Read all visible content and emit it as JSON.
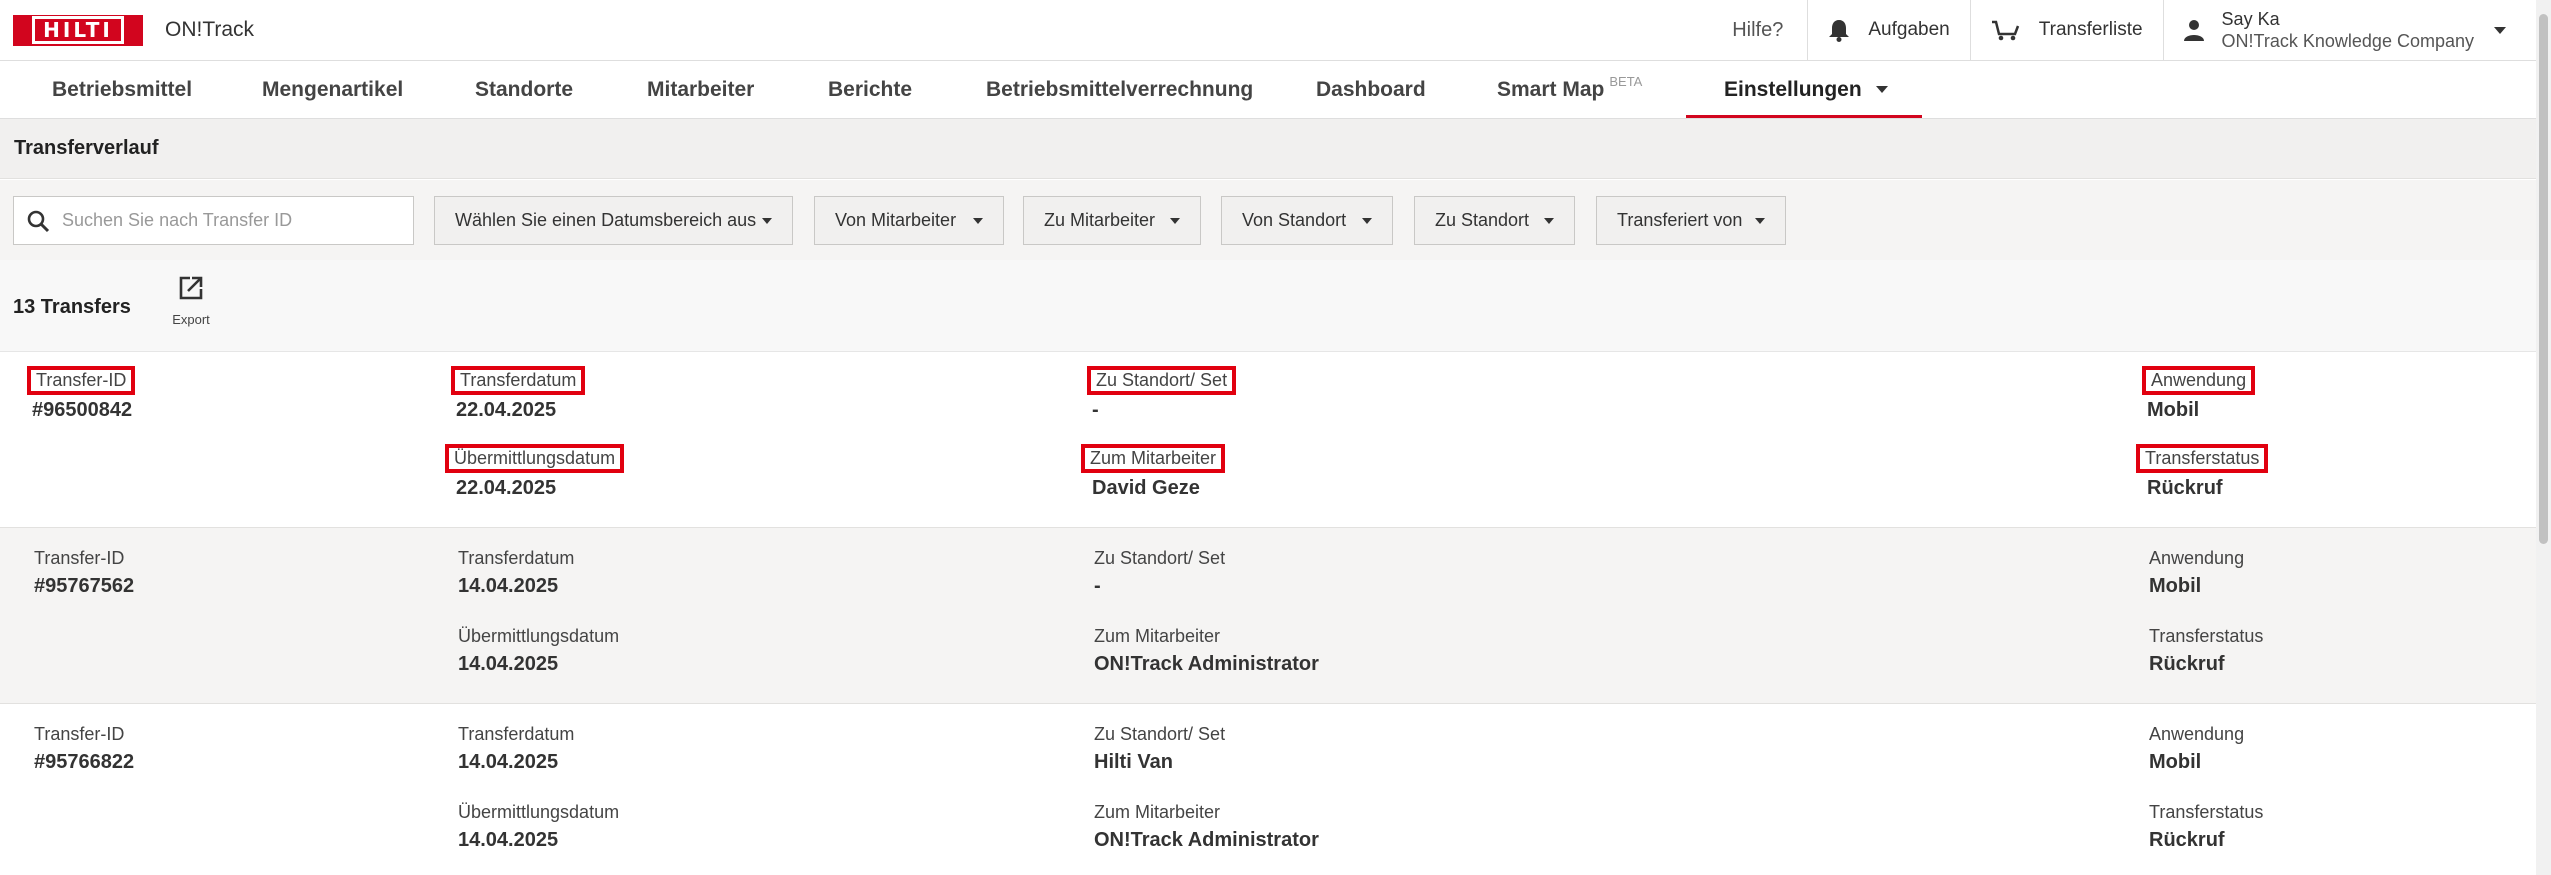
{
  "header": {
    "brand": "HILTI",
    "app_name": "ON!Track",
    "help": "Hilfe?",
    "tasks": "Aufgaben",
    "transfer_list": "Transferliste",
    "user_name": "Say Ka",
    "user_company": "ON!Track Knowledge Company"
  },
  "nav": {
    "tabs": [
      {
        "label": "Betriebsmittel"
      },
      {
        "label": "Mengenartikel"
      },
      {
        "label": "Standorte"
      },
      {
        "label": "Mitarbeiter"
      },
      {
        "label": "Berichte"
      },
      {
        "label": "Betriebsmittelverrechnung"
      },
      {
        "label": "Dashboard"
      },
      {
        "label": "Smart Map",
        "badge": "BETA"
      },
      {
        "label": "Einstellungen",
        "active": true
      }
    ]
  },
  "page": {
    "title": "Transferverlauf"
  },
  "filters": {
    "search_placeholder": "Suchen Sie nach Transfer ID",
    "date_range": "Wählen Sie einen Datumsbereich aus",
    "from_worker": "Von Mitarbeiter",
    "to_worker": "Zu Mitarbeiter",
    "from_location": "Von Standort",
    "to_location": "Zu Standort",
    "transferred_by": "Transferiert von"
  },
  "summary": {
    "count": "13 Transfers",
    "export": "Export"
  },
  "labels": {
    "transfer_id": "Transfer-ID",
    "transfer_date": "Transferdatum",
    "submission_date": "Übermittlungsdatum",
    "to_location": "Zu Standort/ Set",
    "to_worker": "Zum Mitarbeiter",
    "application": "Anwendung",
    "status": "Transferstatus"
  },
  "transfers": [
    {
      "id": "#96500842",
      "transfer_date": "22.04.2025",
      "submission_date": "22.04.2025",
      "to_location": "-",
      "to_worker": "David Geze",
      "application": "Mobil",
      "status": "Rückruf"
    },
    {
      "id": "#95767562",
      "transfer_date": "14.04.2025",
      "submission_date": "14.04.2025",
      "to_location": "-",
      "to_worker": "ON!Track Administrator",
      "application": "Mobil",
      "status": "Rückruf"
    },
    {
      "id": "#95766822",
      "transfer_date": "14.04.2025",
      "submission_date": "14.04.2025",
      "to_location": "Hilti Van",
      "to_worker": "ON!Track Administrator",
      "application": "Mobil",
      "status": "Rückruf"
    }
  ],
  "colors": {
    "brand_red": "#d2051e",
    "highlight_red": "#e1000f"
  }
}
